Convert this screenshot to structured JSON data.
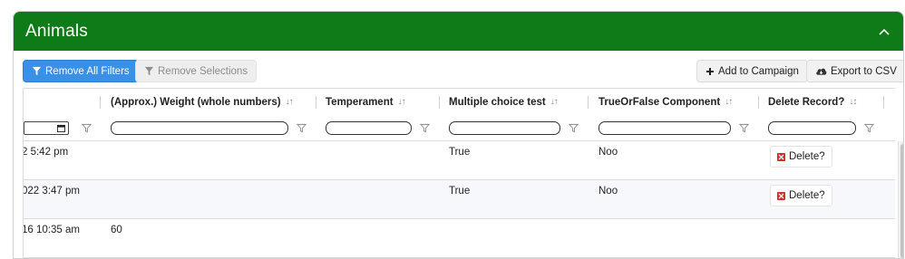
{
  "panel": {
    "title": "Animals"
  },
  "toolbar": {
    "remove_all_filters": "Remove All Filters",
    "remove_selections": "Remove Selections",
    "add_to_campaign": "Add to Campaign",
    "export_csv": "Export to CSV"
  },
  "grid": {
    "columns": [
      {
        "label": ""
      },
      {
        "label": "(Approx.) Weight (whole numbers)",
        "sort_icon": "↓↑"
      },
      {
        "label": "Temperament",
        "sort_icon": "↓↑"
      },
      {
        "label": "Multiple choice test",
        "sort_icon": "↓↑"
      },
      {
        "label": "TrueOrFalse Component",
        "sort_icon": "↓↑"
      },
      {
        "label": "Delete Record?",
        "sort_icon": "↓↕"
      }
    ],
    "rows": [
      {
        "date": "2 5:42 pm",
        "weight": "",
        "temperament": "",
        "multiple_choice": "True",
        "true_or_false": "Noo",
        "delete": "Delete?"
      },
      {
        "date": "022 3:47 pm",
        "weight": "",
        "temperament": "",
        "multiple_choice": "True",
        "true_or_false": "Noo",
        "delete": "Delete?"
      },
      {
        "date": "16 10:35 am",
        "weight": "60",
        "temperament": "",
        "multiple_choice": "",
        "true_or_false": "",
        "delete": ""
      }
    ]
  },
  "colors": {
    "header_green": "#0f7a18",
    "primary_blue": "#3a8fe6",
    "delete_red": "#d42a2a"
  },
  "icons": [
    "chevron-up-icon",
    "filter-icon",
    "plus-icon",
    "cloud-download-icon",
    "calendar-icon",
    "delete-x-icon"
  ]
}
